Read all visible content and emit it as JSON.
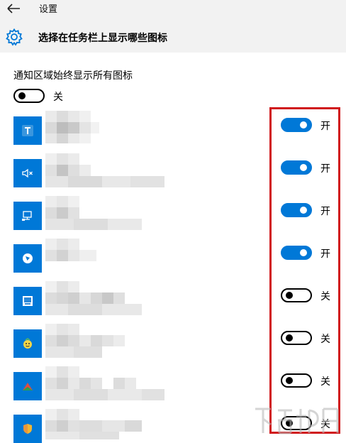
{
  "app": {
    "title": "设置"
  },
  "page": {
    "title": "选择在任务栏上显示哪些图标"
  },
  "always_show": {
    "label": "通知区域始终显示所有图标",
    "state_label": "关",
    "on": false
  },
  "toggle_labels": {
    "on": "开",
    "off": "关"
  },
  "icons": [
    {
      "icon": "text-t-icon",
      "on": true,
      "state_label": "开"
    },
    {
      "icon": "speaker-mute-icon",
      "on": true,
      "state_label": "开"
    },
    {
      "icon": "network-monitor-icon",
      "on": true,
      "state_label": "开"
    },
    {
      "icon": "shield-badge-icon",
      "on": true,
      "state_label": "开"
    },
    {
      "icon": "monitor-app-icon",
      "on": false,
      "state_label": "关"
    },
    {
      "icon": "smiley-app-icon",
      "on": false,
      "state_label": "关"
    },
    {
      "icon": "red-arrow-app-icon",
      "on": false,
      "state_label": "关"
    },
    {
      "icon": "shield-gold-icon",
      "on": false,
      "state_label": "关"
    }
  ],
  "colors": {
    "accent": "#0078d7",
    "highlight_border": "#d0171b",
    "header_bg": "#f2f2f2"
  }
}
